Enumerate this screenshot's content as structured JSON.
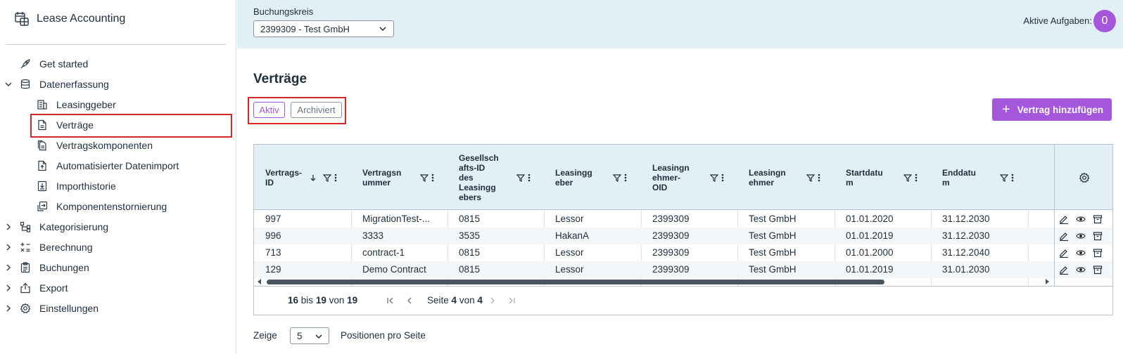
{
  "app": {
    "title": "Lease Accounting"
  },
  "sidebar": {
    "items": [
      {
        "label": "Get started"
      },
      {
        "label": "Datenerfassung"
      },
      {
        "label": "Leasinggeber"
      },
      {
        "label": "Verträge"
      },
      {
        "label": "Vertragskomponenten"
      },
      {
        "label": "Automatisierter Datenimport"
      },
      {
        "label": "Importhistorie"
      },
      {
        "label": "Komponentenstornierung"
      },
      {
        "label": "Kategorisierung"
      },
      {
        "label": "Berechnung"
      },
      {
        "label": "Buchungen"
      },
      {
        "label": "Export"
      },
      {
        "label": "Einstellungen"
      }
    ]
  },
  "header": {
    "company_code_label": "Buchungskreis",
    "company_code_value": "2399309 - Test GmbH",
    "tasks_label": "Aktive Aufgaben:",
    "tasks_count": "0"
  },
  "main": {
    "title": "Verträge",
    "toggle_active": "Aktiv",
    "toggle_archived": "Archiviert",
    "add_button": "Vertrag hinzufügen",
    "add_icon": "+"
  },
  "table": {
    "columns": [
      {
        "label": "Vertrags-ID"
      },
      {
        "label": "Vertragsnummer"
      },
      {
        "label": "Gesellschafts-ID des Leasinggebers"
      },
      {
        "label": "Leasinggeber"
      },
      {
        "label": "Leasingnehmer-OID"
      },
      {
        "label": "Leasingnehmer"
      },
      {
        "label": "Startdatum"
      },
      {
        "label": "Enddatum"
      }
    ],
    "column_labels_wrapped": [
      "Vertrags-\nID",
      "Vertragsn\nummer",
      "Gesellsch\nafts-ID\ndes\nLeasingg\nebers",
      "Leasingg\neber",
      "Leasingn\nehmer-\nOID",
      "Leasingn\nehmer",
      "Startdatu\nm",
      "Enddatu\nm"
    ],
    "rows": [
      [
        "997",
        "MigrationTest-...",
        "0815",
        "Lessor",
        "2399309",
        "Test GmbH",
        "01.01.2020",
        "31.12.2030"
      ],
      [
        "996",
        "3333",
        "3535",
        "HakanA",
        "2399309",
        "Test GmbH",
        "01.01.2019",
        "31.12.2030"
      ],
      [
        "713",
        "contract-1",
        "0815",
        "Lessor",
        "2399309",
        "Test GmbH",
        "01.01.2000",
        "31.12.2040"
      ],
      [
        "129",
        "Demo Contract",
        "0815",
        "Lessor",
        "2399309",
        "Test GmbH",
        "01.01.2019",
        "31.01.2030"
      ]
    ]
  },
  "pager": {
    "range_from": "16",
    "range_to_word": "bis",
    "range_to": "19",
    "of_word": "von",
    "total": "19",
    "page_word": "Seite",
    "page": "4",
    "page_of_word": "von",
    "pages": "4"
  },
  "footer": {
    "show_label": "Zeige",
    "page_size": "5",
    "per_page_label": "Positionen pro Seite"
  },
  "colors": {
    "accent": "#a457db",
    "header_band": "#e2eff4",
    "highlight_box": "#d9262b"
  }
}
